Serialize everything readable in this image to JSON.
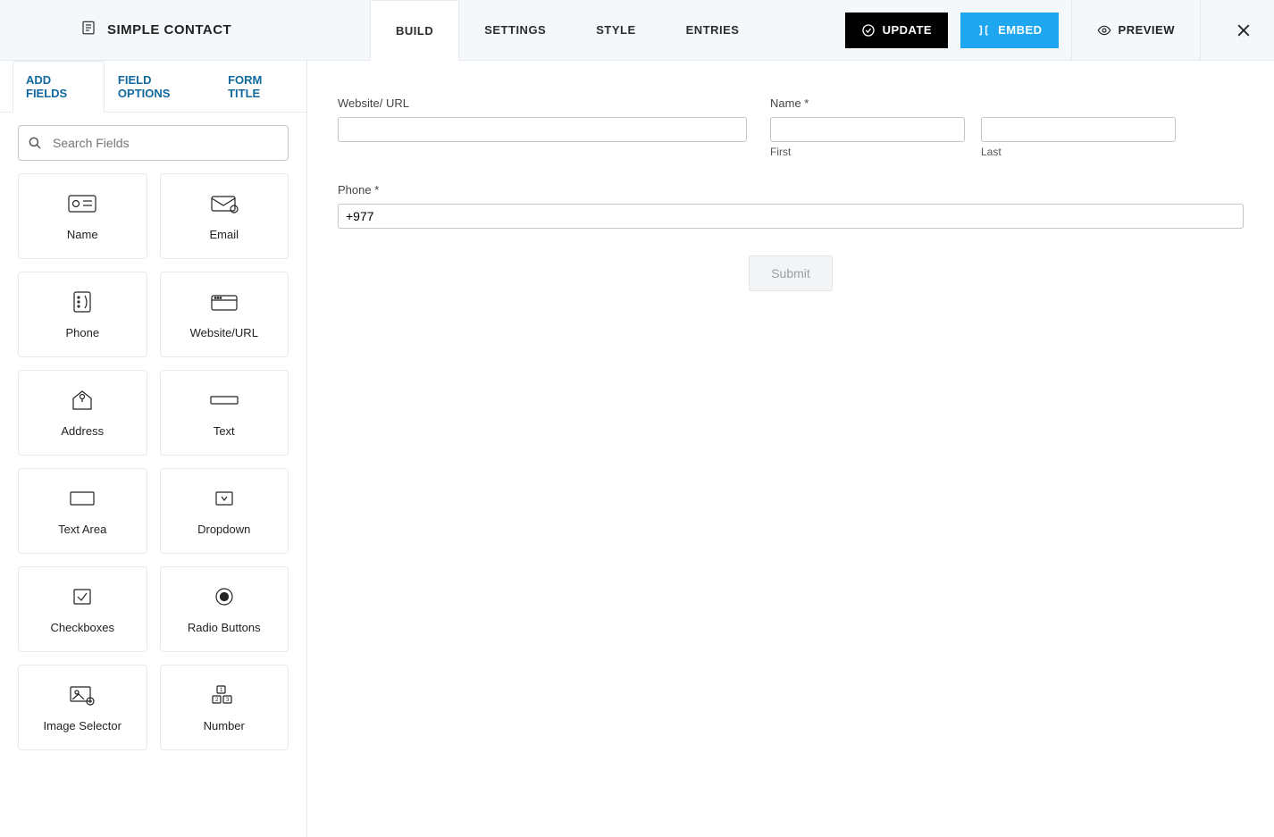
{
  "header": {
    "form_title": "SIMPLE CONTACT",
    "tabs": [
      "BUILD",
      "SETTINGS",
      "STYLE",
      "ENTRIES"
    ],
    "active_tab": 0,
    "update_label": "UPDATE",
    "embed_label": "EMBED",
    "preview_label": "PREVIEW"
  },
  "sidebar": {
    "tabs": [
      "ADD FIELDS",
      "FIELD OPTIONS",
      "FORM TITLE"
    ],
    "active_tab": 0,
    "search_placeholder": "Search Fields",
    "fields": [
      {
        "label": "Name",
        "icon": "name"
      },
      {
        "label": "Email",
        "icon": "email"
      },
      {
        "label": "Phone",
        "icon": "phone"
      },
      {
        "label": "Website/URL",
        "icon": "url"
      },
      {
        "label": "Address",
        "icon": "address"
      },
      {
        "label": "Text",
        "icon": "text"
      },
      {
        "label": "Text Area",
        "icon": "textarea"
      },
      {
        "label": "Dropdown",
        "icon": "dropdown"
      },
      {
        "label": "Checkboxes",
        "icon": "checkbox"
      },
      {
        "label": "Radio Buttons",
        "icon": "radio"
      },
      {
        "label": "Image Selector",
        "icon": "image"
      },
      {
        "label": "Number",
        "icon": "number"
      }
    ]
  },
  "form": {
    "website_label": "Website/ URL",
    "name_label": "Name *",
    "first_label": "First",
    "last_label": "Last",
    "phone_label": "Phone *",
    "phone_value": "+977",
    "submit_label": "Submit"
  }
}
